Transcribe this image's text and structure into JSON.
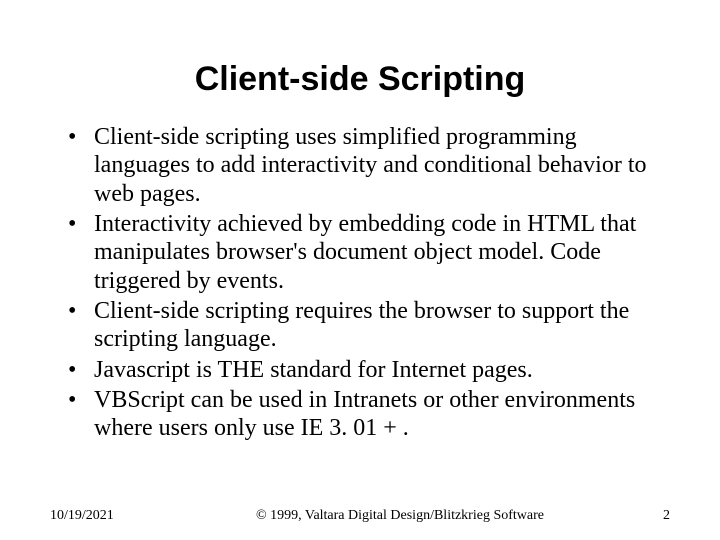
{
  "title": "Client-side Scripting",
  "bullets": [
    "Client-side scripting uses simplified programming languages to add interactivity and conditional behavior to web pages.",
    "Interactivity achieved by embedding code in HTML that manipulates browser's document object model. Code triggered by events.",
    "Client-side scripting requires the browser to support the scripting language.",
    "Javascript is THE standard for Internet pages.",
    "VBScript can be used in Intranets or other environments where users only use IE 3. 01 + ."
  ],
  "footer": {
    "date": "10/19/2021",
    "copyright": "© 1999, Valtara Digital Design/Blitzkrieg Software",
    "page": "2"
  }
}
